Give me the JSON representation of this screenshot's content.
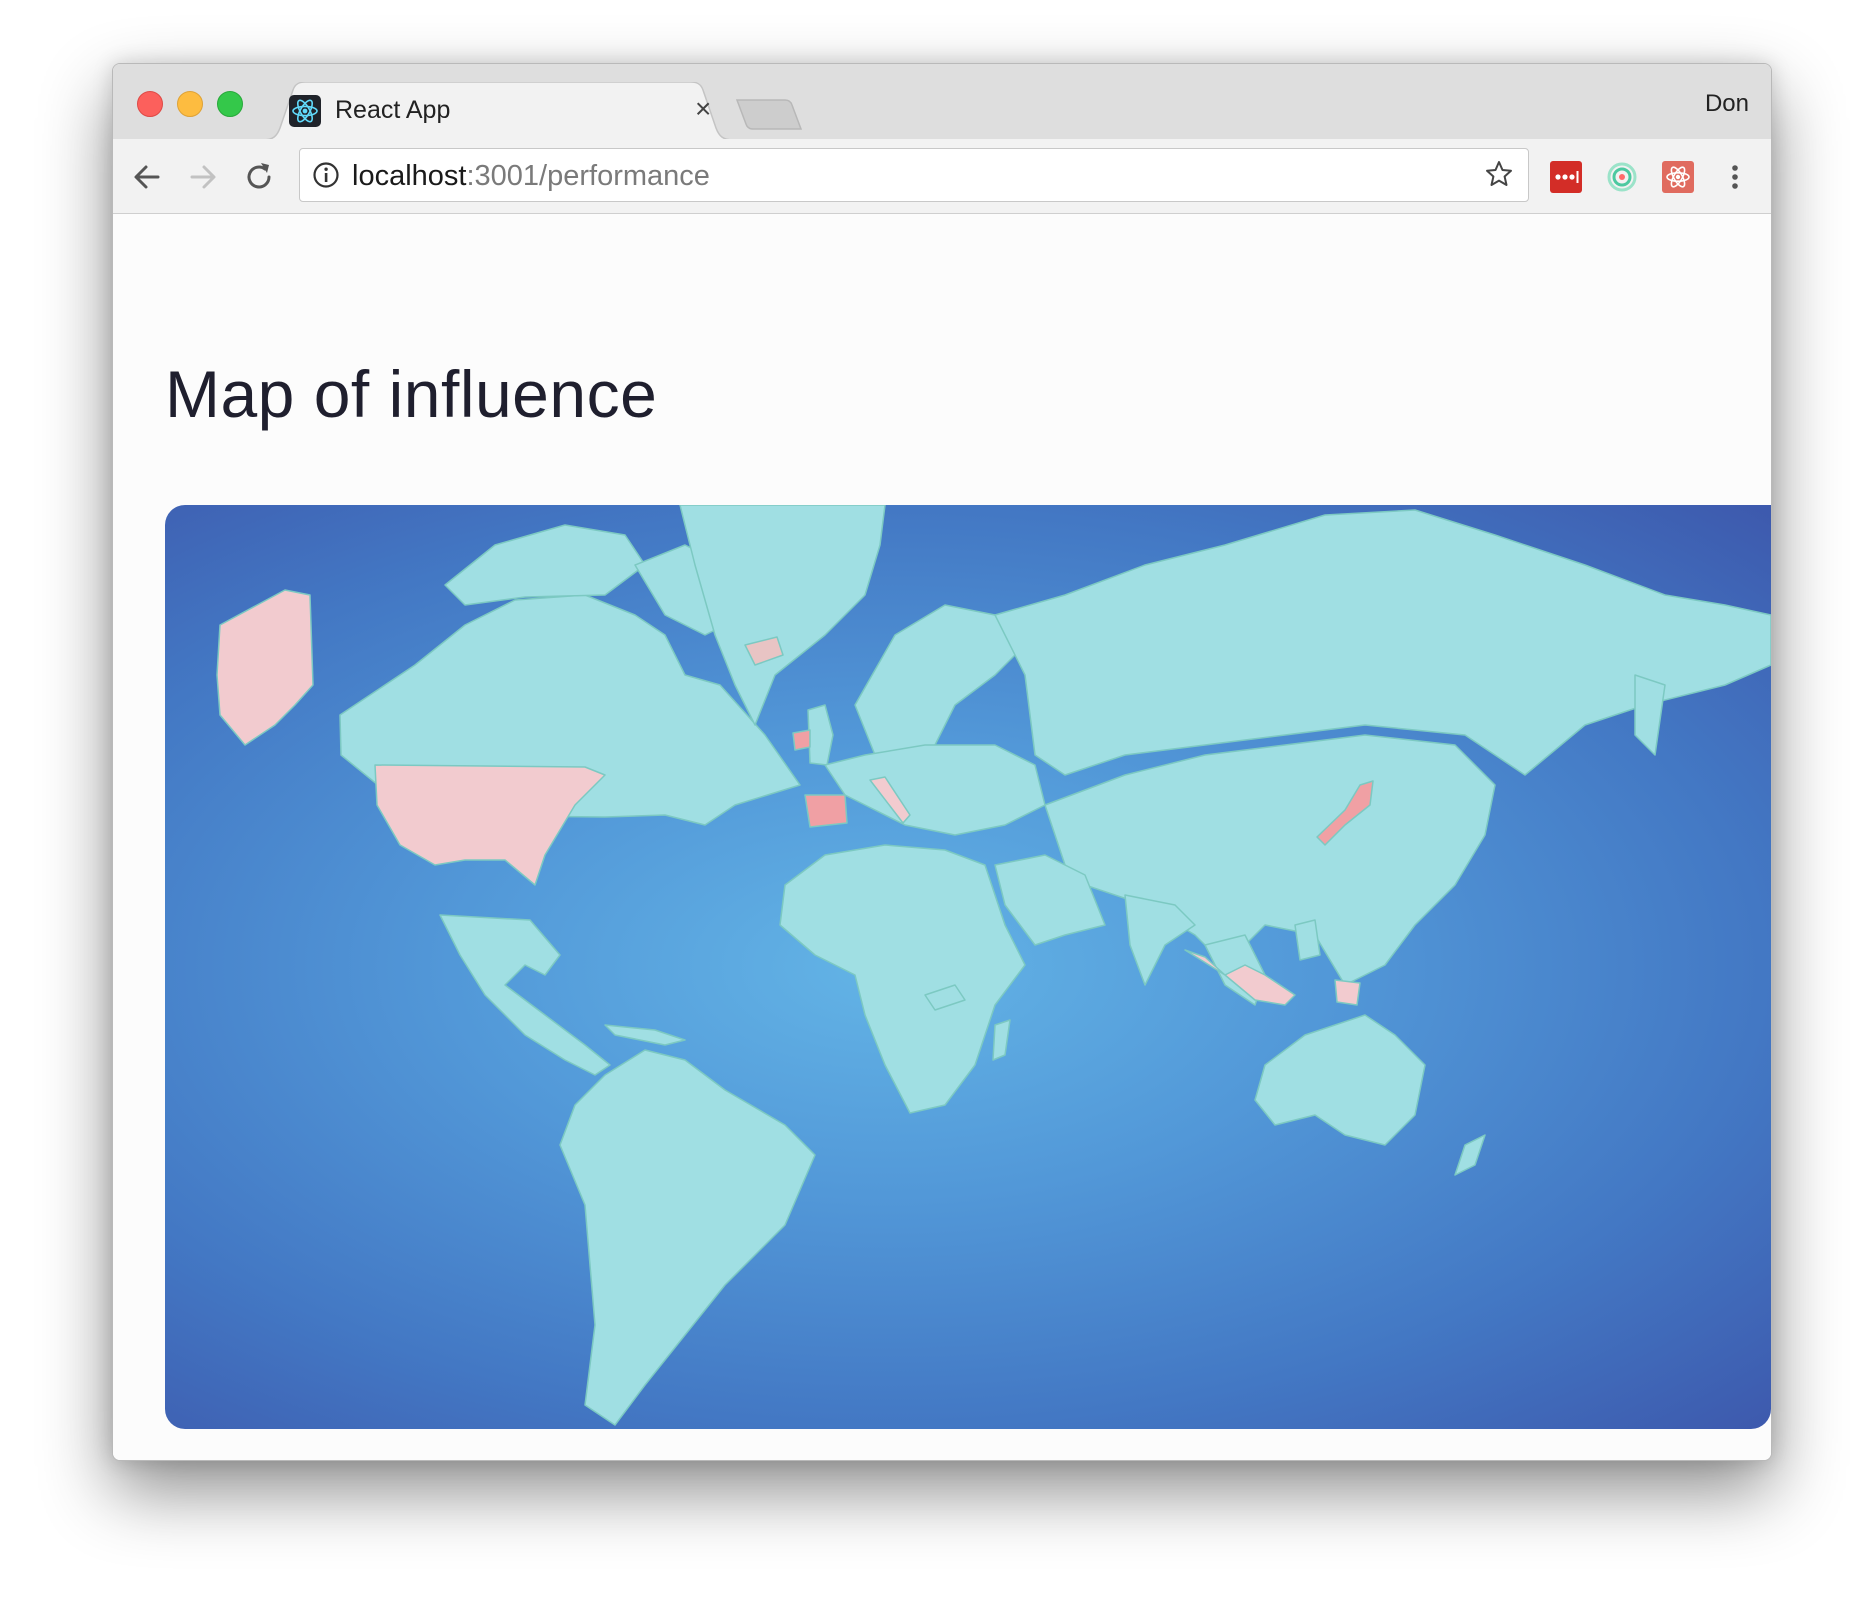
{
  "window": {
    "profile_name": "Don",
    "tab": {
      "title": "React App",
      "icon": "react-logo-icon"
    },
    "address": {
      "host": "localhost",
      "path": ":3001/performance"
    }
  },
  "toolbar": {
    "icons": [
      "back-arrow-icon",
      "forward-arrow-icon",
      "reload-icon",
      "info-icon",
      "bookmark-star-icon",
      "lastpass-extension-icon",
      "target-extension-icon",
      "react-devtools-extension-icon",
      "menu-kebab-icon"
    ]
  },
  "page": {
    "heading": "Map of influence"
  },
  "map": {
    "ocean_colors": {
      "center": "#63b4e6",
      "edge": "#3d59ad"
    },
    "land_color": "#a0dfe3",
    "border_color": "#7cc9c2",
    "highlight_light": "#f2cbcf",
    "highlight_strong": "#f0a0a4",
    "highlighted_regions": [
      "Alaska",
      "United States",
      "Iceland",
      "Ireland",
      "Spain",
      "Italy",
      "Japan",
      "Indonesia",
      "Papua New Guinea"
    ]
  }
}
